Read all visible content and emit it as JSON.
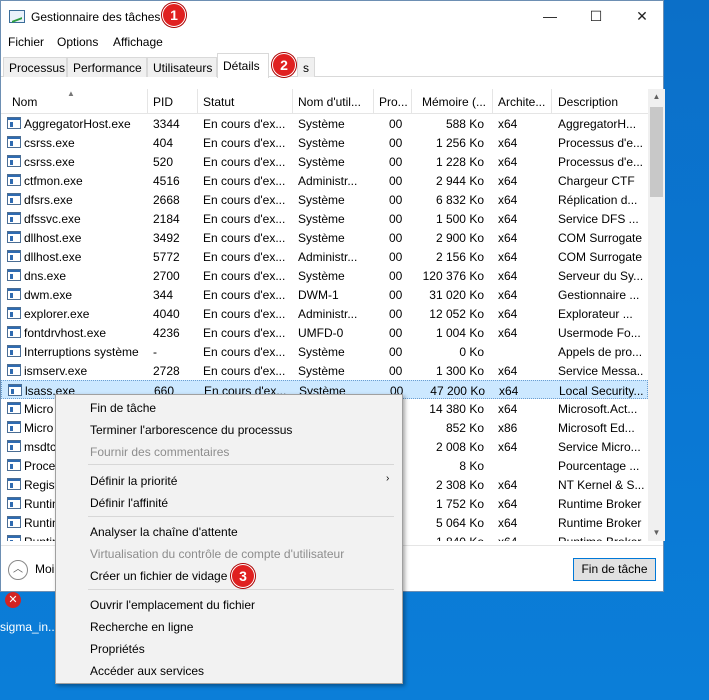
{
  "window": {
    "title": "Gestionnaire des tâches",
    "min_glyph": "—",
    "max_glyph": "☐",
    "close_glyph": "✕"
  },
  "menu": [
    "Fichier",
    "Options",
    "Affichage"
  ],
  "tabs": [
    "Processus",
    "Performance",
    "Utilisateurs",
    "Détails",
    "s"
  ],
  "columns": [
    "Nom",
    "PID",
    "Statut",
    "Nom d'util...",
    "Pro...",
    "Mémoire (...",
    "Archite...",
    "Description"
  ],
  "rows": [
    {
      "name": "AggregatorHost.exe",
      "pid": "3344",
      "status": "En cours d'ex...",
      "user": "Système",
      "cpu": "00",
      "mem": "588 Ko",
      "arch": "x64",
      "desc": "AggregatorH..."
    },
    {
      "name": "csrss.exe",
      "pid": "404",
      "status": "En cours d'ex...",
      "user": "Système",
      "cpu": "00",
      "mem": "1 256 Ko",
      "arch": "x64",
      "desc": "Processus d'e..."
    },
    {
      "name": "csrss.exe",
      "pid": "520",
      "status": "En cours d'ex...",
      "user": "Système",
      "cpu": "00",
      "mem": "1 228 Ko",
      "arch": "x64",
      "desc": "Processus d'e..."
    },
    {
      "name": "ctfmon.exe",
      "pid": "4516",
      "status": "En cours d'ex...",
      "user": "Administr...",
      "cpu": "00",
      "mem": "2 944 Ko",
      "arch": "x64",
      "desc": "Chargeur CTF"
    },
    {
      "name": "dfsrs.exe",
      "pid": "2668",
      "status": "En cours d'ex...",
      "user": "Système",
      "cpu": "00",
      "mem": "6 832 Ko",
      "arch": "x64",
      "desc": "Réplication d..."
    },
    {
      "name": "dfssvc.exe",
      "pid": "2184",
      "status": "En cours d'ex...",
      "user": "Système",
      "cpu": "00",
      "mem": "1 500 Ko",
      "arch": "x64",
      "desc": "Service DFS ..."
    },
    {
      "name": "dllhost.exe",
      "pid": "3492",
      "status": "En cours d'ex...",
      "user": "Système",
      "cpu": "00",
      "mem": "2 900 Ko",
      "arch": "x64",
      "desc": "COM Surrogate"
    },
    {
      "name": "dllhost.exe",
      "pid": "5772",
      "status": "En cours d'ex...",
      "user": "Administr...",
      "cpu": "00",
      "mem": "2 156 Ko",
      "arch": "x64",
      "desc": "COM Surrogate"
    },
    {
      "name": "dns.exe",
      "pid": "2700",
      "status": "En cours d'ex...",
      "user": "Système",
      "cpu": "00",
      "mem": "120 376 Ko",
      "arch": "x64",
      "desc": "Serveur du Sy..."
    },
    {
      "name": "dwm.exe",
      "pid": "344",
      "status": "En cours d'ex...",
      "user": "DWM-1",
      "cpu": "00",
      "mem": "31 020 Ko",
      "arch": "x64",
      "desc": "Gestionnaire ..."
    },
    {
      "name": "explorer.exe",
      "pid": "4040",
      "status": "En cours d'ex...",
      "user": "Administr...",
      "cpu": "00",
      "mem": "12 052 Ko",
      "arch": "x64",
      "desc": "Explorateur ..."
    },
    {
      "name": "fontdrvhost.exe",
      "pid": "4236",
      "status": "En cours d'ex...",
      "user": "UMFD-0",
      "cpu": "00",
      "mem": "1 004 Ko",
      "arch": "x64",
      "desc": "Usermode Fo..."
    },
    {
      "name": "Interruptions système",
      "pid": "-",
      "status": "En cours d'ex...",
      "user": "Système",
      "cpu": "00",
      "mem": "0 Ko",
      "arch": "",
      "desc": "Appels de pro..."
    },
    {
      "name": "ismserv.exe",
      "pid": "2728",
      "status": "En cours d'ex...",
      "user": "Système",
      "cpu": "00",
      "mem": "1 300 Ko",
      "arch": "x64",
      "desc": "Service Messa..."
    },
    {
      "name": "lsass.exe",
      "pid": "660",
      "status": "En cours d'ex...",
      "user": "Système",
      "cpu": "00",
      "mem": "47 200 Ko",
      "arch": "x64",
      "desc": "Local Security..."
    },
    {
      "name": "Micro",
      "pid": "",
      "status": "",
      "user": "",
      "cpu": "",
      "mem": "14 380 Ko",
      "arch": "x64",
      "desc": "Microsoft.Act..."
    },
    {
      "name": "Micro",
      "pid": "",
      "status": "",
      "user": "",
      "cpu": "",
      "mem": "852 Ko",
      "arch": "x86",
      "desc": "Microsoft Ed..."
    },
    {
      "name": "msdtc",
      "pid": "",
      "status": "",
      "user": "",
      "cpu": "",
      "mem": "2 008 Ko",
      "arch": "x64",
      "desc": "Service Micro..."
    },
    {
      "name": "Proces",
      "pid": "",
      "status": "",
      "user": "",
      "cpu": "",
      "mem": "8 Ko",
      "arch": "",
      "desc": "Pourcentage ..."
    },
    {
      "name": "Regist",
      "pid": "",
      "status": "",
      "user": "",
      "cpu": "",
      "mem": "2 308 Ko",
      "arch": "x64",
      "desc": "NT Kernel & S..."
    },
    {
      "name": "Runtin",
      "pid": "",
      "status": "",
      "user": "",
      "cpu": "",
      "mem": "1 752 Ko",
      "arch": "x64",
      "desc": "Runtime Broker"
    },
    {
      "name": "Runtin",
      "pid": "",
      "status": "",
      "user": "",
      "cpu": "",
      "mem": "5 064 Ko",
      "arch": "x64",
      "desc": "Runtime Broker"
    },
    {
      "name": "Runtin",
      "pid": "",
      "status": "",
      "user": "",
      "cpu": "",
      "mem": "1 840 Ko",
      "arch": "x64",
      "desc": "Runtime Broker"
    }
  ],
  "bottom": {
    "fewer_details": "Moi",
    "end_task": "Fin de tâche"
  },
  "context_menu": [
    {
      "label": "Fin de tâche",
      "disabled": false
    },
    {
      "label": "Terminer l'arborescence du processus",
      "disabled": false
    },
    {
      "label": "Fournir des commentaires",
      "disabled": true
    },
    {
      "label": "Définir la priorité",
      "disabled": false
    },
    {
      "label": "Définir l'affinité",
      "disabled": false
    },
    {
      "label": "Analyser la chaîne d'attente",
      "disabled": false
    },
    {
      "label": "Virtualisation du contrôle de compte d'utilisateur",
      "disabled": true
    },
    {
      "label": "Créer un fichier de vidage",
      "disabled": false
    },
    {
      "label": "Ouvrir l'emplacement du fichier",
      "disabled": false
    },
    {
      "label": "Recherche en ligne",
      "disabled": false
    },
    {
      "label": "Propriétés",
      "disabled": false
    },
    {
      "label": "Accéder aux services",
      "disabled": false
    }
  ],
  "submenu_arrow": "›",
  "badges": [
    "1",
    "2",
    "3"
  ],
  "desktop_icon_label": "sigma_in...",
  "colors": {
    "selected_row": "#cce8ff",
    "badge": "#e02020",
    "desktop": "#0a78d4"
  }
}
